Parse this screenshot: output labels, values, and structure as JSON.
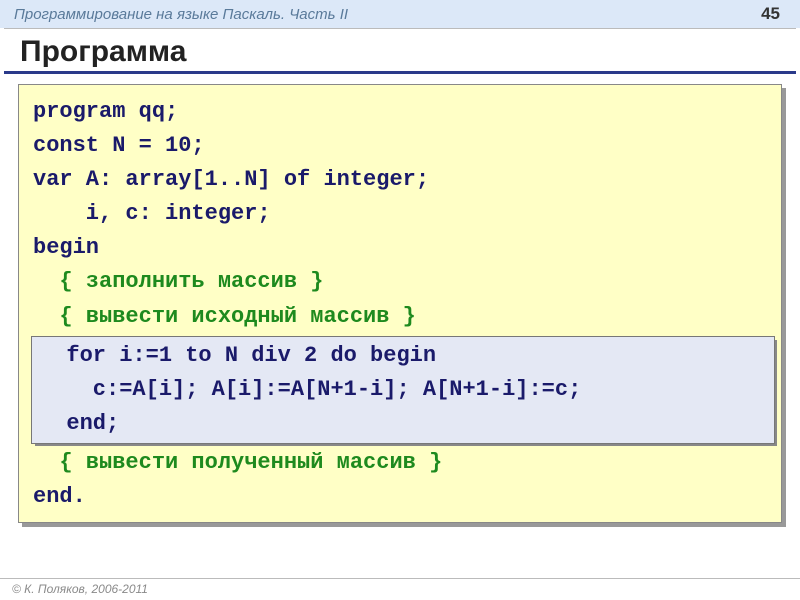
{
  "header": {
    "course_title": "Программирование на языке Паскаль. Часть II",
    "page_number": "45"
  },
  "title": "Программа",
  "code": {
    "line1": "program qq;",
    "line2": "const N = 10;",
    "line3": "var A: array[1..N] of integer;",
    "line4": "    i, c: integer;",
    "line5": "begin",
    "comment1": "  { заполнить массив }",
    "comment2": "  { вывести исходный массив }",
    "inner1": "  for i:=1 to N div 2 do begin",
    "inner2": "    c:=A[i]; A[i]:=A[N+1-i]; A[N+1-i]:=c;",
    "inner3": "  end;",
    "comment3": "  { вывести полученный массив }",
    "line_end": "end."
  },
  "footer": "© К. Поляков, 2006-2011"
}
